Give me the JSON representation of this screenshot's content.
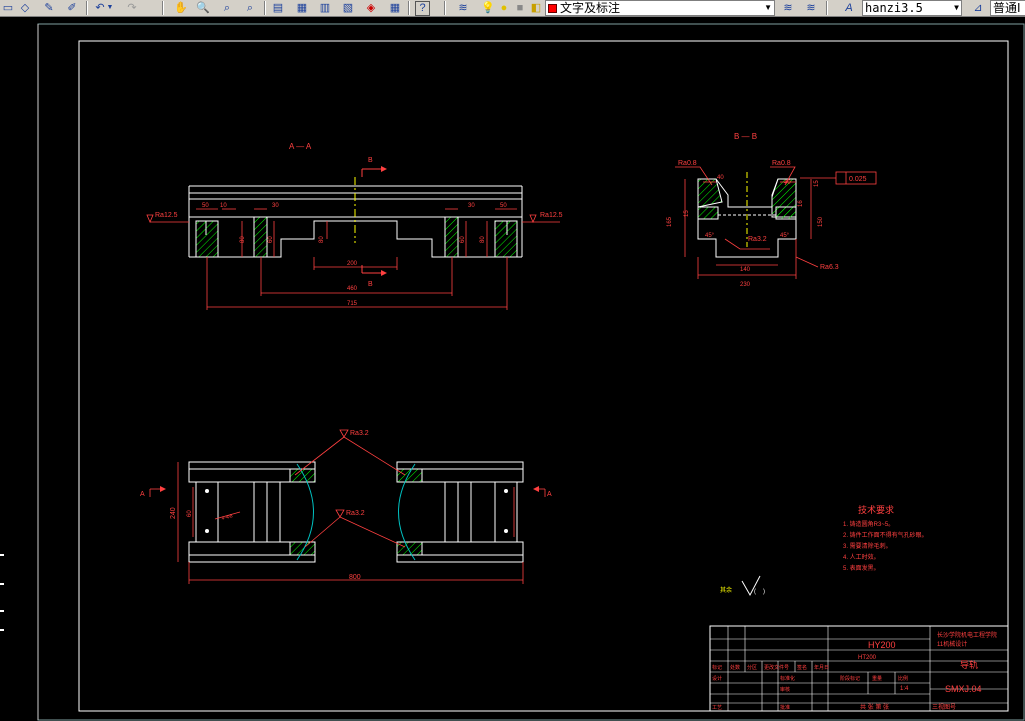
{
  "toolbar": {
    "text_style_combo": "文字及标注",
    "font_combo": "hanzi3.5",
    "dim_style_combo": "普通Ⅰ",
    "icons": [
      "new-file-icon",
      "open-folder-icon",
      "pencil-icon",
      "brush-icon",
      "undo-icon",
      "redo-icon",
      "pan-icon",
      "zoom-realtime-icon",
      "zoom-window-icon",
      "zoom-previous-icon",
      "properties-icon",
      "design-center-icon",
      "tool-palettes-icon",
      "sheet-set-icon",
      "markup-icon",
      "calculator-icon",
      "help-icon",
      "layer-manager-icon",
      "bulb-on-icon",
      "sun-icon",
      "lock-icon",
      "layer-color-icon",
      "layer-states-icon",
      "layer-previous-icon",
      "text-style-icon"
    ]
  },
  "drawing": {
    "view_aa_label": "A — A",
    "view_bb_label": "B — B",
    "section_b_top": "B",
    "section_b_bottom": "B",
    "section_a_left": "A",
    "section_a_right": "A",
    "front": {
      "dims": {
        "d50_left": "50",
        "d10_left": "10",
        "d30_left": "30",
        "d30_right": "30",
        "d50_right": "50",
        "d200": "200",
        "d460": "460",
        "d715": "715",
        "h80_left": "80",
        "h80_mid": "80",
        "h80_right": "80",
        "h60_a": "60",
        "h60_b": "60"
      },
      "roughness_left": "Ra12.5",
      "roughness_right": "Ra12.5"
    },
    "section_bb": {
      "roughness_top_left": "Ra0.8",
      "roughness_top_right": "Ra0.8",
      "roughness_bottom": "Ra3.2",
      "roughness_right": "Ra6.3",
      "flatness": "0.025",
      "dims": {
        "d40_left": "40",
        "d40_right": "40",
        "d15": "15",
        "d165": "165",
        "d150": "150",
        "d45_left": "45°",
        "d45_right": "45°",
        "d140": "140",
        "d230": "230",
        "d15b": "15",
        "d16": "16"
      }
    },
    "plan": {
      "dims": {
        "d800": "800",
        "d240": "240",
        "d60": "60",
        "d4": "4-Φ8"
      },
      "roughness_top": "Ra3.2",
      "roughness_mid": "Ra3.2"
    },
    "notes": {
      "title": "技术要求",
      "items": [
        "1. 铸造圆角R3~5。",
        "2. 铸件工作面不得有气孔砂眼。",
        "3. 需要清除毛刺。",
        "4. 人工时效。",
        "5. 表面发黑。"
      ]
    },
    "other_roughness": "其余"
  },
  "title_block": {
    "drawing_code": "HY200",
    "school_line1": "长沙学院机电工程学院",
    "school_line2": "11机械设计",
    "part_name": "导轨",
    "drawing_number": "SMXJ.04",
    "material": "HT200",
    "scale": "1:4",
    "sheet": "共   张   第   张",
    "headers": [
      "标记",
      "处数",
      "分区",
      "更改文件号",
      "签名",
      "年月日"
    ],
    "row_design": "设计",
    "row_std": "标准化",
    "row_stage": "阶段标记",
    "row_weight": "重量",
    "row_ratio": "比例",
    "row_check": "审核",
    "row_craft": "工艺",
    "row_approve": "批准",
    "projection": "三视图号"
  }
}
